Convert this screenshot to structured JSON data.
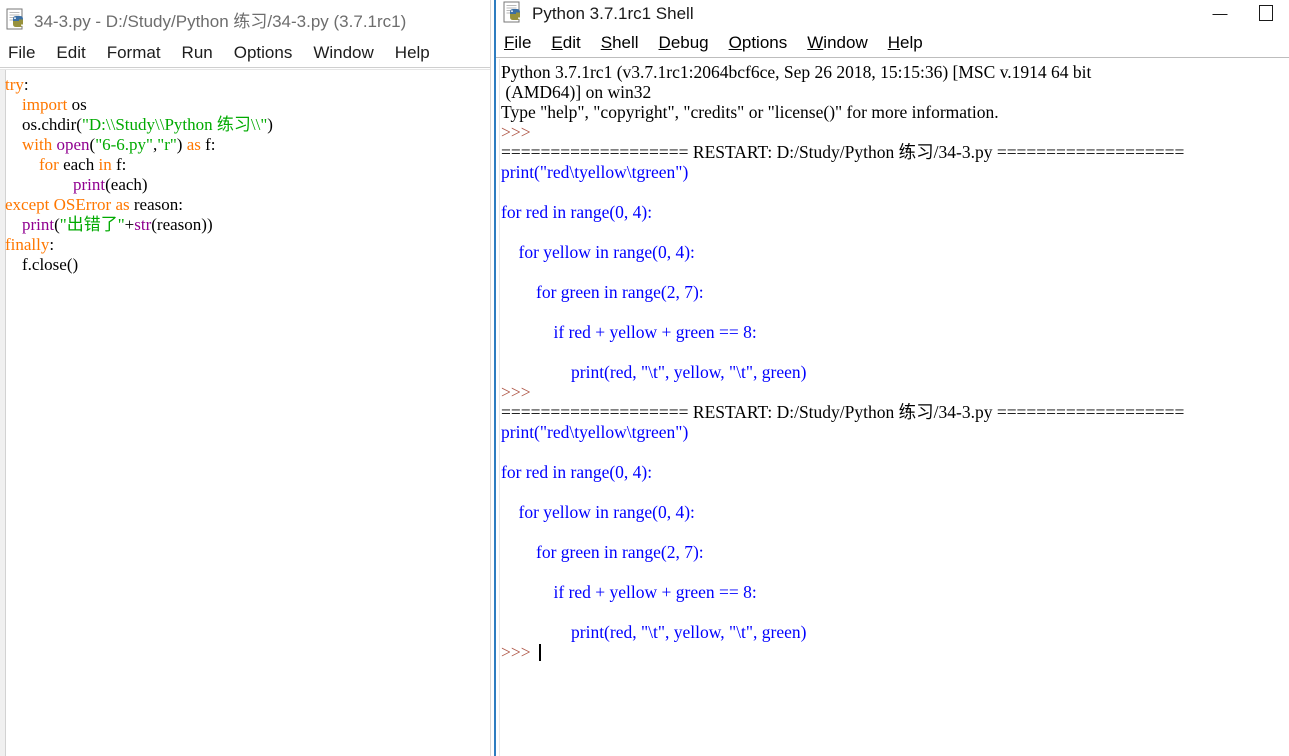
{
  "editor_window": {
    "icon": "python-file-icon",
    "title": "34-3.py - D:/Study/Python 练习/34-3.py (3.7.1rc1)",
    "menu": [
      {
        "label": "File"
      },
      {
        "label": "Edit"
      },
      {
        "label": "Format"
      },
      {
        "label": "Run"
      },
      {
        "label": "Options"
      },
      {
        "label": "Window"
      },
      {
        "label": "Help"
      }
    ],
    "code_lines": [
      {
        "segments": [
          {
            "t": "try",
            "c": "kw"
          },
          {
            "t": ":",
            "c": "pl"
          }
        ]
      },
      {
        "segments": [
          {
            "t": "    ",
            "c": "pl"
          },
          {
            "t": "import",
            "c": "kw"
          },
          {
            "t": " os",
            "c": "pl"
          }
        ]
      },
      {
        "segments": [
          {
            "t": "    os.chdir(",
            "c": "pl"
          },
          {
            "t": "\"D:\\\\Study\\\\Python 练习\\\\\"",
            "c": "str"
          },
          {
            "t": ")",
            "c": "pl"
          }
        ]
      },
      {
        "segments": [
          {
            "t": "    ",
            "c": "pl"
          },
          {
            "t": "with",
            "c": "kw"
          },
          {
            "t": " ",
            "c": "pl"
          },
          {
            "t": "open",
            "c": "bi"
          },
          {
            "t": "(",
            "c": "pl"
          },
          {
            "t": "\"6-6.py\"",
            "c": "str"
          },
          {
            "t": ",",
            "c": "pl"
          },
          {
            "t": "\"r\"",
            "c": "str"
          },
          {
            "t": ") ",
            "c": "pl"
          },
          {
            "t": "as",
            "c": "kw"
          },
          {
            "t": " f:",
            "c": "pl"
          }
        ]
      },
      {
        "segments": [
          {
            "t": "        ",
            "c": "pl"
          },
          {
            "t": "for",
            "c": "kw"
          },
          {
            "t": " each ",
            "c": "pl"
          },
          {
            "t": "in",
            "c": "kw"
          },
          {
            "t": " f:",
            "c": "pl"
          }
        ]
      },
      {
        "segments": [
          {
            "t": "                ",
            "c": "pl"
          },
          {
            "t": "print",
            "c": "bi"
          },
          {
            "t": "(each)",
            "c": "pl"
          }
        ]
      },
      {
        "segments": [
          {
            "t": "except",
            "c": "kw"
          },
          {
            "t": " ",
            "c": "pl"
          },
          {
            "t": "OSError",
            "c": "kw"
          },
          {
            "t": " ",
            "c": "pl"
          },
          {
            "t": "as",
            "c": "kw"
          },
          {
            "t": " reason:",
            "c": "pl"
          }
        ]
      },
      {
        "segments": [
          {
            "t": "    ",
            "c": "pl"
          },
          {
            "t": "print",
            "c": "bi"
          },
          {
            "t": "(",
            "c": "pl"
          },
          {
            "t": "\"出错了\"",
            "c": "str"
          },
          {
            "t": "+",
            "c": "pl"
          },
          {
            "t": "str",
            "c": "bi"
          },
          {
            "t": "(reason))",
            "c": "pl"
          }
        ]
      },
      {
        "segments": [
          {
            "t": "finally",
            "c": "kw"
          },
          {
            "t": ":",
            "c": "pl"
          }
        ]
      },
      {
        "segments": [
          {
            "t": "    f.close()",
            "c": "pl"
          }
        ]
      }
    ]
  },
  "shell_window": {
    "icon": "python-shell-icon",
    "title": "Python 3.7.1rc1 Shell",
    "window_buttons": [
      {
        "name": "minimize-button",
        "glyph": "minimize-icon"
      },
      {
        "name": "maximize-button",
        "glyph": "maximize-icon"
      }
    ],
    "menu": [
      {
        "label": "File",
        "mnemonic": "F",
        "rest": "ile"
      },
      {
        "label": "Edit",
        "mnemonic": "E",
        "rest": "dit"
      },
      {
        "label": "Shell",
        "mnemonic": "S",
        "rest": "hell"
      },
      {
        "label": "Debug",
        "mnemonic": "D",
        "rest": "ebug"
      },
      {
        "label": "Options",
        "mnemonic": "O",
        "rest": "ptions"
      },
      {
        "label": "Window",
        "mnemonic": "W",
        "rest": "indow"
      },
      {
        "label": "Help",
        "mnemonic": "H",
        "rest": "elp"
      }
    ],
    "lines": [
      {
        "cls": "restart",
        "text": "Python 3.7.1rc1 (v3.7.1rc1:2064bcf6ce, Sep 26 2018, 15:15:36) [MSC v.1914 64 bit"
      },
      {
        "cls": "restart",
        "text": " (AMD64)] on win32"
      },
      {
        "cls": "restart",
        "text": "Type \"help\", \"copyright\", \"credits\" or \"license()\" for more information."
      },
      {
        "cls": "prompt",
        "text": ">>> "
      },
      {
        "cls": "restart",
        "text": "=================== RESTART: D:/Study/Python 练习/34-3.py ==================="
      },
      {
        "cls": "out",
        "text": "print(\"red\\tyellow\\tgreen\")"
      },
      {
        "cls": "out",
        "text": ""
      },
      {
        "cls": "out",
        "text": "for red in range(0, 4):"
      },
      {
        "cls": "out",
        "text": ""
      },
      {
        "cls": "out",
        "text": "    for yellow in range(0, 4):"
      },
      {
        "cls": "out",
        "text": ""
      },
      {
        "cls": "out",
        "text": "        for green in range(2, 7):"
      },
      {
        "cls": "out",
        "text": ""
      },
      {
        "cls": "out",
        "text": "            if red + yellow + green == 8:"
      },
      {
        "cls": "out",
        "text": ""
      },
      {
        "cls": "out",
        "text": "                print(red, \"\\t\", yellow, \"\\t\", green)"
      },
      {
        "cls": "prompt",
        "text": ">>> "
      },
      {
        "cls": "restart",
        "text": "=================== RESTART: D:/Study/Python 练习/34-3.py ==================="
      },
      {
        "cls": "out",
        "text": "print(\"red\\tyellow\\tgreen\")"
      },
      {
        "cls": "out",
        "text": ""
      },
      {
        "cls": "out",
        "text": "for red in range(0, 4):"
      },
      {
        "cls": "out",
        "text": ""
      },
      {
        "cls": "out",
        "text": "    for yellow in range(0, 4):"
      },
      {
        "cls": "out",
        "text": ""
      },
      {
        "cls": "out",
        "text": "        for green in range(2, 7):"
      },
      {
        "cls": "out",
        "text": ""
      },
      {
        "cls": "out",
        "text": "            if red + yellow + green == 8:"
      },
      {
        "cls": "out",
        "text": ""
      },
      {
        "cls": "out",
        "text": "                print(red, \"\\t\", yellow, \"\\t\", green)"
      }
    ],
    "final_prompt": ">>> ",
    "cursor_visible": true
  },
  "colors": {
    "keyword": "#ff7700",
    "builtin": "#900090",
    "string": "#00aa00",
    "shell_output": "#0000ff",
    "prompt": "#b05a4a",
    "window_accent": "#2e7dc0"
  }
}
